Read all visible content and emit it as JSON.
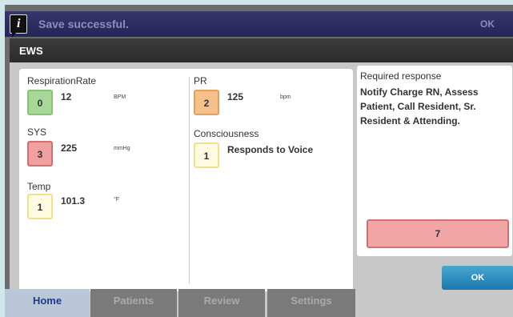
{
  "notification": {
    "message": "Save successful.",
    "ok_label": "OK",
    "icon": "info-icon"
  },
  "modal": {
    "title": "EWS"
  },
  "vitals": {
    "respiration": {
      "label": "RespirationRate",
      "score": "0",
      "value": "12",
      "unit": "BPM",
      "score_color": "#a8d898"
    },
    "sys": {
      "label": "SYS",
      "score": "3",
      "value": "225",
      "unit": "mmHg",
      "score_color": "#f0a0a0"
    },
    "temp": {
      "label": "Temp",
      "score": "1",
      "value": "101.3",
      "unit": "°F",
      "score_color": "#fffbe0"
    },
    "pr": {
      "label": "PR",
      "score": "2",
      "value": "125",
      "unit": "bpm",
      "score_color": "#f6c08a"
    },
    "consciousness": {
      "label": "Consciousness",
      "score": "1",
      "value": "Responds to Voice",
      "score_color": "#fffbe0"
    }
  },
  "response": {
    "heading": "Required response",
    "text": "Notify Charge RN, Assess Patient, Call Resident, Sr. Resident & Attending.",
    "total_score": "7"
  },
  "buttons": {
    "ok_label": "OK"
  },
  "nav": {
    "tabs": [
      {
        "label": "Home",
        "active": true
      },
      {
        "label": "Patients",
        "active": false
      },
      {
        "label": "Review",
        "active": false
      },
      {
        "label": "Settings",
        "active": false
      }
    ]
  },
  "colors": {
    "accent": "#1a7aad",
    "notify_bar": "#2a2a60",
    "alert": "#f2a5a5"
  }
}
